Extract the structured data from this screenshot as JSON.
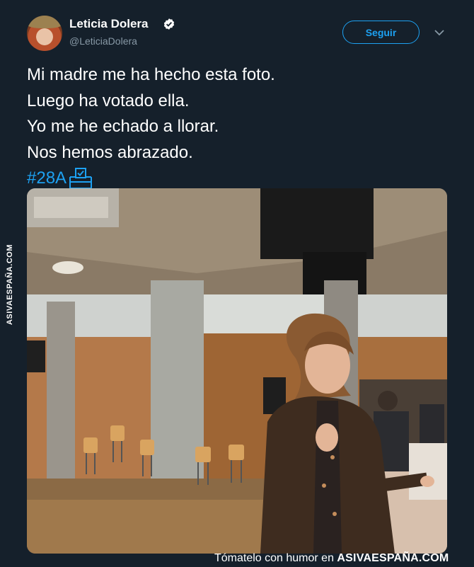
{
  "tweet": {
    "display_name": "Leticia Dolera",
    "handle": "@LeticiaDolera",
    "follow_label": "Seguir",
    "text_lines": [
      "Mi madre me ha hecho esta foto.",
      "Luego ha votado ella.",
      "Yo me he echado a llorar.",
      "Nos hemos abrazado."
    ],
    "hashtag": "#28A",
    "icons": {
      "verified": "verified-badge-icon",
      "chevron": "chevron-down-icon",
      "ballot": "ballot-box-emoji-icon"
    }
  },
  "watermark": {
    "side_text": "ASIVAESPAÑA.COM",
    "footer_prefix": "Tómatelo con humor en ",
    "footer_brand": "ASIVAESPAÑA.COM"
  },
  "colors": {
    "background": "#15202b",
    "accent": "#1da1f2",
    "secondary_text": "#8899a6"
  }
}
